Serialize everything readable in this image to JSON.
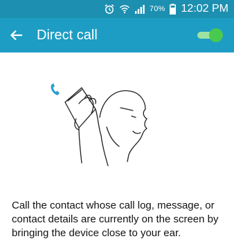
{
  "status_bar": {
    "alarm_icon": "alarm-icon",
    "wifi_icon": "wifi-icon",
    "signal_icon": "signal-icon",
    "battery_percent": "70%",
    "battery_icon": "battery-icon",
    "time": "12:02 PM"
  },
  "app_bar": {
    "back_icon": "arrow-left-icon",
    "title": "Direct call",
    "toggle_state": "on"
  },
  "content": {
    "illustration": "phone-to-ear-illustration",
    "description": "Call the contact whose call log, message, or contact details are currently on the screen by bringing the device close to your ear."
  },
  "colors": {
    "status_bar": "#1d8fb0",
    "app_bar": "#1d9dc4",
    "toggle_on": "#4ac94f",
    "phone_accent": "#2a9fd0"
  }
}
